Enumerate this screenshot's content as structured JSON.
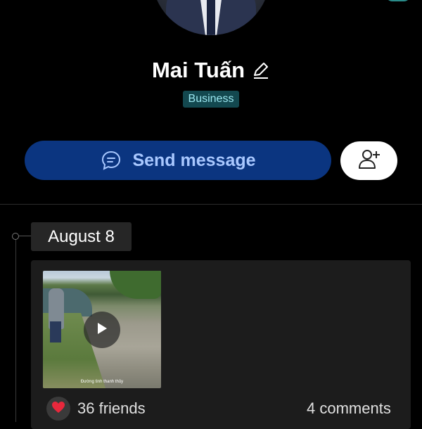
{
  "profile": {
    "name": "Mai Tuấn",
    "badge": "Business"
  },
  "actions": {
    "send_message_label": "Send message"
  },
  "timeline": {
    "date": "August 8"
  },
  "post": {
    "thumbnail_caption": "Đường tình thanh thủy",
    "reaction_icon": "heart-icon",
    "friends_label": "36 friends",
    "comments_label": "4 comments"
  },
  "colors": {
    "background": "#000000",
    "send_button": "#0b3580",
    "send_text": "#a9c8ff",
    "badge_bg": "#13484f",
    "badge_text": "#9be7f0",
    "card_bg": "#1c1c1c",
    "heart": "#e8283c"
  },
  "icons": [
    "edit-icon",
    "message-icon",
    "add-friend-icon",
    "play-icon",
    "heart-icon"
  ]
}
